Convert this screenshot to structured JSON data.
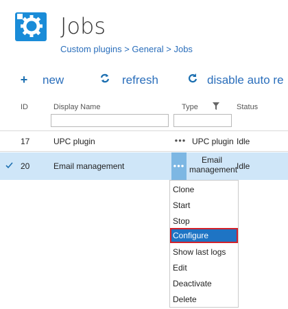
{
  "page": {
    "title": "Jobs",
    "breadcrumb": "Custom plugins > General > Jobs",
    "icon": "gear-plug-icon"
  },
  "toolbar": {
    "new_label": "new",
    "refresh_label": "refresh",
    "disable_label": "disable auto re"
  },
  "table": {
    "columns": [
      "ID",
      "Display Name",
      "Type",
      "Status"
    ],
    "rows": [
      {
        "id": "17",
        "name": "UPC plugin",
        "type": "UPC plugin",
        "status": "Idle",
        "selected": false,
        "more": "•••"
      },
      {
        "id": "20",
        "name": "Email management",
        "type_line1": "Email",
        "type_line2": "management",
        "status": "Idle",
        "selected": true,
        "more": "•••"
      }
    ]
  },
  "context_menu": {
    "items": [
      "Clone",
      "Start",
      "Stop",
      "Configure",
      "Show last logs",
      "Edit",
      "Deactivate",
      "Delete"
    ],
    "highlighted": "Configure"
  },
  "colors": {
    "accent": "#1a8cd8",
    "link": "#2a6ebb",
    "selected_row": "#cfe6f8",
    "highlight_border": "#d3212a"
  }
}
